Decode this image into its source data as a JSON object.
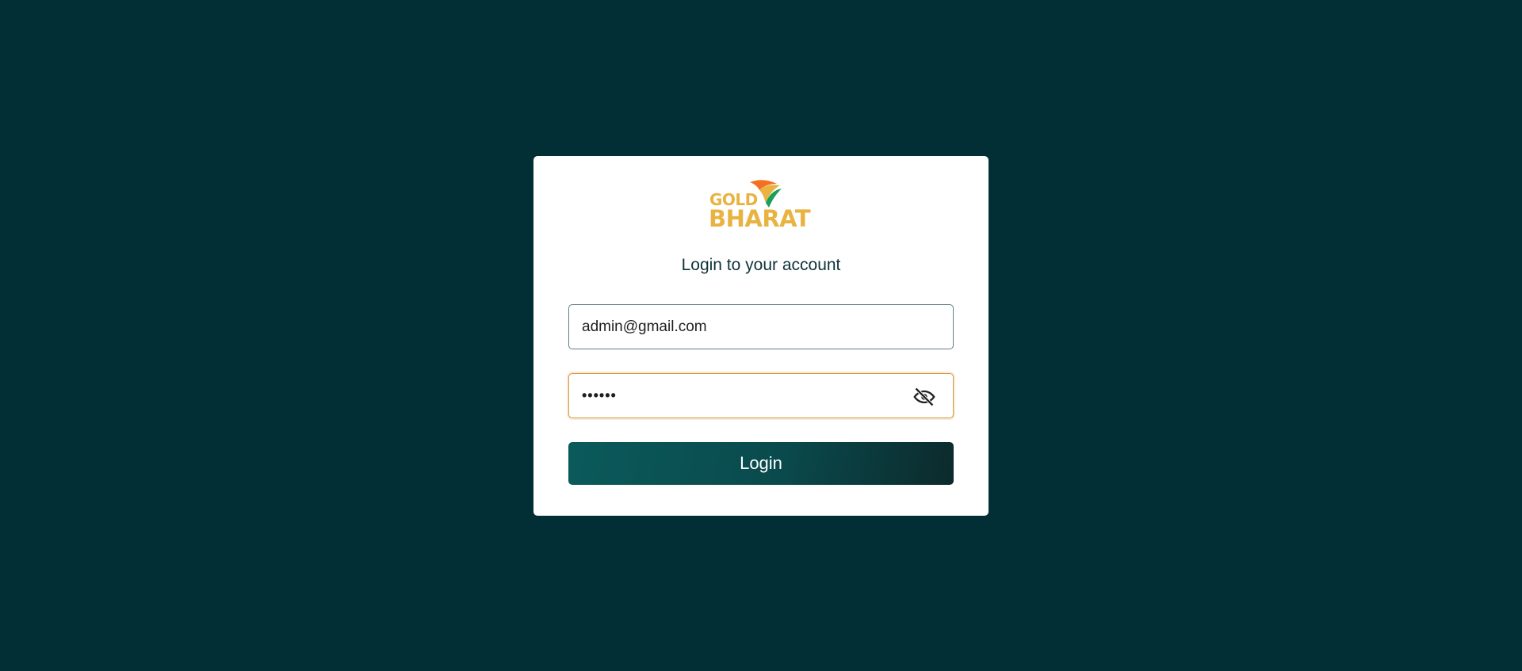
{
  "logo": {
    "text_top": "GOLD",
    "text_bottom": "BHARAT",
    "text_color": "#e9b341",
    "accent_colors": [
      "#f37021",
      "#1a9e5a"
    ]
  },
  "form": {
    "title": "Login to your account",
    "email_value": "admin@gmail.com",
    "password_value": "••••••",
    "password_toggle_icon": "eye-slash-icon",
    "submit_label": "Login"
  },
  "colors": {
    "background": "#012f35",
    "card": "#ffffff",
    "button_gradient": [
      "#0b5a5b",
      "#0c2a2c"
    ],
    "focus_border": "#d49a47"
  }
}
